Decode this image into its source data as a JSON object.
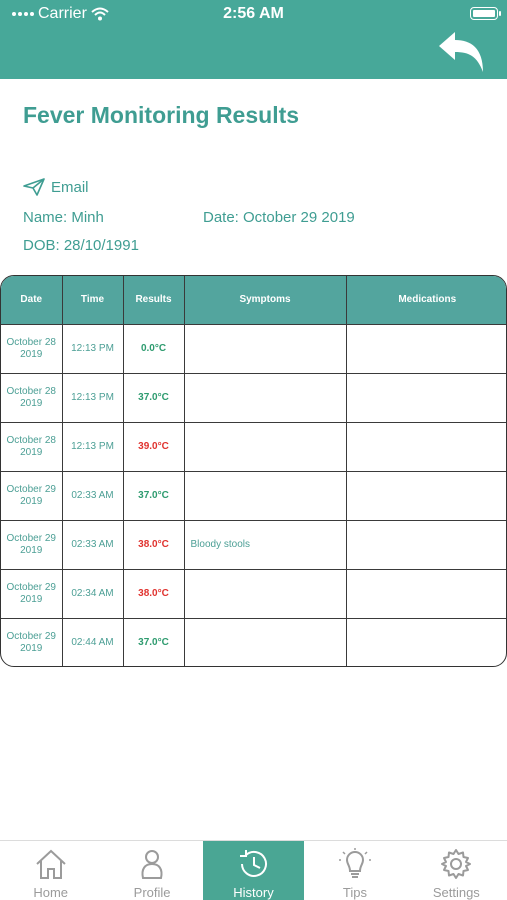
{
  "status": {
    "carrier": "Carrier",
    "time": "2:56 AM"
  },
  "header": {
    "back_icon": "back-arrow-icon",
    "color": "#47a899"
  },
  "report": {
    "title": "Fever Monitoring Results",
    "email_label": "Email",
    "name": "Name: Minh",
    "date": "Date: October 29 2019",
    "dob": "DOB: 28/10/1991"
  },
  "table": {
    "headers": [
      "Date",
      "Time",
      "Results",
      "Symptoms",
      "Medications"
    ],
    "rows": [
      {
        "date": "October 28 2019",
        "time": "12:13 PM",
        "result": "0.0°C",
        "status": "normal",
        "symptoms": "",
        "medications": ""
      },
      {
        "date": "October 28 2019",
        "time": "12:13 PM",
        "result": "37.0°C",
        "status": "normal",
        "symptoms": "",
        "medications": ""
      },
      {
        "date": "October 28 2019",
        "time": "12:13 PM",
        "result": "39.0°C",
        "status": "fever",
        "symptoms": "",
        "medications": ""
      },
      {
        "date": "October 29 2019",
        "time": "02:33 AM",
        "result": "37.0°C",
        "status": "normal",
        "symptoms": "",
        "medications": ""
      },
      {
        "date": "October 29 2019",
        "time": "02:33 AM",
        "result": "38.0°C",
        "status": "fever",
        "symptoms": "Bloody stools",
        "medications": ""
      },
      {
        "date": "October 29 2019",
        "time": "02:34 AM",
        "result": "38.0°C",
        "status": "fever",
        "symptoms": "",
        "medications": ""
      },
      {
        "date": "October 29 2019",
        "time": "02:44 AM",
        "result": "37.0°C",
        "status": "normal",
        "symptoms": "",
        "medications": ""
      }
    ]
  },
  "tabs": [
    {
      "label": "Home",
      "icon": "home-icon",
      "active": false
    },
    {
      "label": "Profile",
      "icon": "profile-icon",
      "active": false
    },
    {
      "label": "History",
      "icon": "history-icon",
      "active": true
    },
    {
      "label": "Tips",
      "icon": "lightbulb-icon",
      "active": false
    },
    {
      "label": "Settings",
      "icon": "gear-icon",
      "active": false
    }
  ],
  "colors": {
    "accent": "#47a899",
    "fever": "#e0332f",
    "normal": "#2e9b6f"
  }
}
